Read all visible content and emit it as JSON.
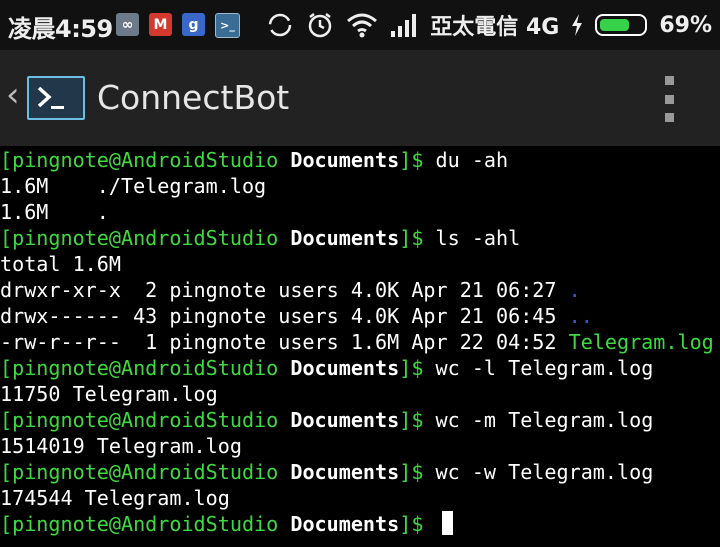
{
  "status_bar": {
    "time": "凌晨4:59",
    "carrier": "亞太電信 4G",
    "battery_percent": "69%",
    "battery_level": 0.69,
    "app_icons": [
      "ifttt-icon",
      "gmail-icon",
      "google-plus-icon",
      "connectbot-icon"
    ],
    "app_icon_glyphs": [
      "∞",
      "M",
      "g",
      ">_"
    ]
  },
  "action_bar": {
    "title": "ConnectBot",
    "logo_glyph": ">_"
  },
  "terminal": {
    "prompt_user": "[pingnote@AndroidStudio ",
    "prompt_dir": "Documents",
    "prompt_end": "]$ ",
    "commands": {
      "c1": "du -ah",
      "c2": "ls -ahl",
      "c3": "wc -l Telegram.log",
      "c4": "wc -m Telegram.log",
      "c5": "wc -w Telegram.log"
    },
    "out_du_1": "1.6M    ./Telegram.log",
    "out_du_2": "1.6M    .",
    "out_ls_total": "total 1.6M",
    "ls_row1_prefix": "drwxr-xr-x  2 pingnote users 4.0K Apr 21 06:27 ",
    "ls_row1_name": ".",
    "ls_row2_prefix": "drwx------ 43 pingnote users 4.0K Apr 21 06:45 ",
    "ls_row2_name": "..",
    "ls_row3_prefix": "-rw-r--r--  1 pingnote users 1.6M Apr 22 04:52 ",
    "ls_row3_name": "Telegram.log",
    "out_wc_l": "11750 Telegram.log",
    "out_wc_m": "1514019 Telegram.log",
    "out_wc_w": "174544 Telegram.log"
  },
  "colors": {
    "prompt_green": "#3ed93e",
    "dir_blue": "#3a53d8",
    "background": "#000000"
  }
}
